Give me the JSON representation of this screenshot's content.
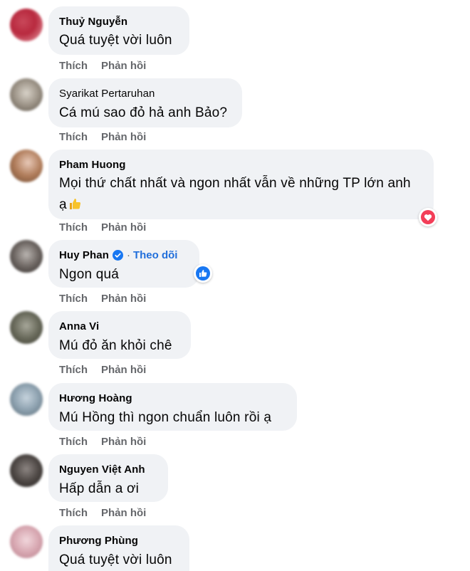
{
  "actions": {
    "like_label": "Thích",
    "reply_label": "Phản hồi"
  },
  "follow_label": "Theo dõi",
  "follow_separator": "·",
  "comments": [
    {
      "name": "Thuỷ Nguyễn",
      "text": "Quá tuyệt vời luôn"
    },
    {
      "name": "Syarikat Pertaruhan",
      "text": "Cá mú sao đỏ hả anh Bảo?"
    },
    {
      "name": "Pham Huong",
      "text_line1": "Mọi thứ chất nhất và ngon nhất vẫn về những TP lớn anh",
      "text_line2": "ạ",
      "emoji": "thumbs-up-emoji",
      "reaction": "love-reaction-icon"
    },
    {
      "name": "Huy Phan",
      "verified": true,
      "text": "Ngon quá",
      "reaction": "like-reaction-icon"
    },
    {
      "name": "Anna Vi",
      "text": "Mú đỏ ăn khỏi chê"
    },
    {
      "name": "Hương Hoàng",
      "text": "Mú Hồng thì ngon chuẩn luôn rồi ạ"
    },
    {
      "name": "Nguyen Việt Anh",
      "text": "Hấp dẫn a ơi"
    },
    {
      "name": "Phương Phùng",
      "text": "Quá tuyệt vời luôn"
    }
  ],
  "colors": {
    "bubble": "#f0f2f5",
    "action_text": "#65676b",
    "follow_link": "#216fdb",
    "love_reaction": "#f33e58",
    "like_reaction": "#1877f2"
  }
}
